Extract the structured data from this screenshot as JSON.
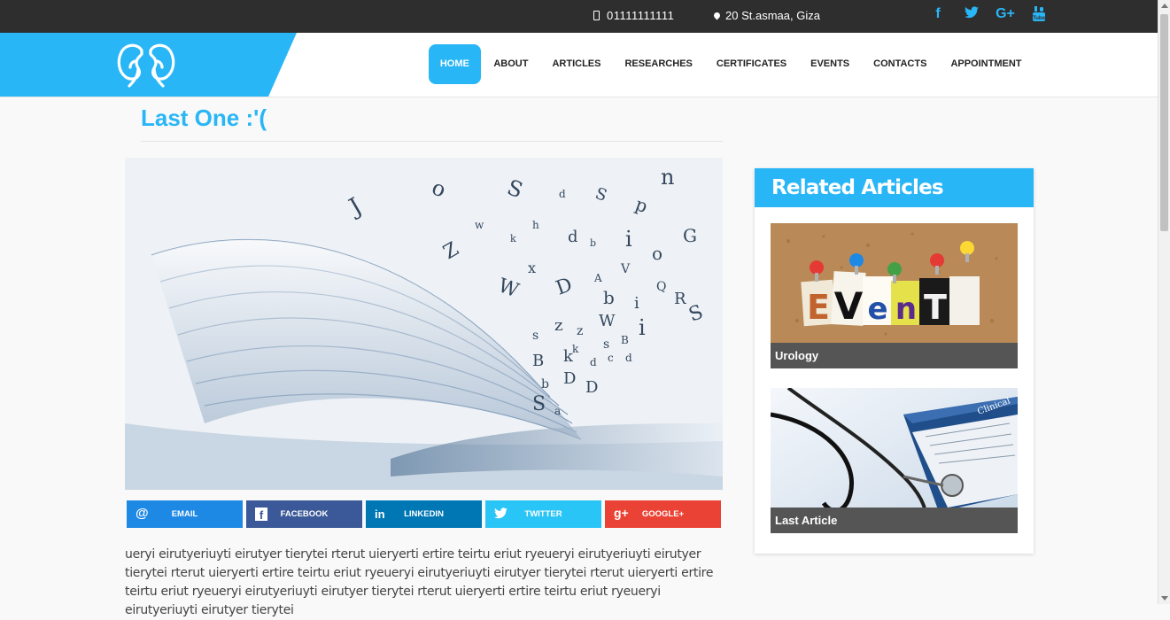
{
  "topbar": {
    "phone": "01111111111",
    "address": "20 St.asmaa, Giza",
    "social": [
      {
        "icon": "facebook-icon",
        "glyph": "f"
      },
      {
        "icon": "twitter-icon",
        "glyph": "t"
      },
      {
        "icon": "google-plus-icon",
        "glyph": "G+"
      },
      {
        "icon": "youtube-icon",
        "glyph": "▣"
      }
    ]
  },
  "nav": {
    "items": [
      "HOME",
      "ABOUT",
      "ARTICLES",
      "RESEARCHES",
      "CERTIFICATES",
      "EVENTS",
      "CONTACTS",
      "APPOINTMENT"
    ]
  },
  "article": {
    "title": "Last One :'(",
    "body": "ueryi eirutyeriuyti eirutyer tierytei rterut uieryerti ertire teirtu eriut ryeueryi eirutyeriuyti eirutyer tierytei rterut uieryerti ertire teirtu eriut ryeueryi eirutyeriuyti eirutyer tierytei rterut uieryerti ertire teirtu eriut ryeueryi eirutyeriuyti eirutyer tierytei rterut uieryerti ertire teirtu eriut ryeueryi eirutyeriuyti eirutyer tierytei"
  },
  "share": {
    "buttons": [
      {
        "label": "EMAIL",
        "glyph": "@",
        "color": "#1e88e5"
      },
      {
        "label": "FACEBOOK",
        "glyph": "f",
        "color": "#3b5998"
      },
      {
        "label": "LINKEDIN",
        "glyph": "in",
        "color": "#0077b5"
      },
      {
        "label": "TWITTER",
        "glyph": "🐦",
        "color": "#29c5f6"
      },
      {
        "label": "GOOGLE+",
        "glyph": "g+",
        "color": "#ea4335"
      }
    ]
  },
  "sidebar": {
    "heading": "Related Articles",
    "cards": [
      {
        "caption": "Urology"
      },
      {
        "caption": "Last Article"
      }
    ],
    "event_letters": [
      "E",
      "V",
      "e",
      "n",
      "T"
    ]
  },
  "colors": {
    "accent": "#29b6f6",
    "topbar": "#2e2e2e",
    "caption_bg": "#555555"
  }
}
